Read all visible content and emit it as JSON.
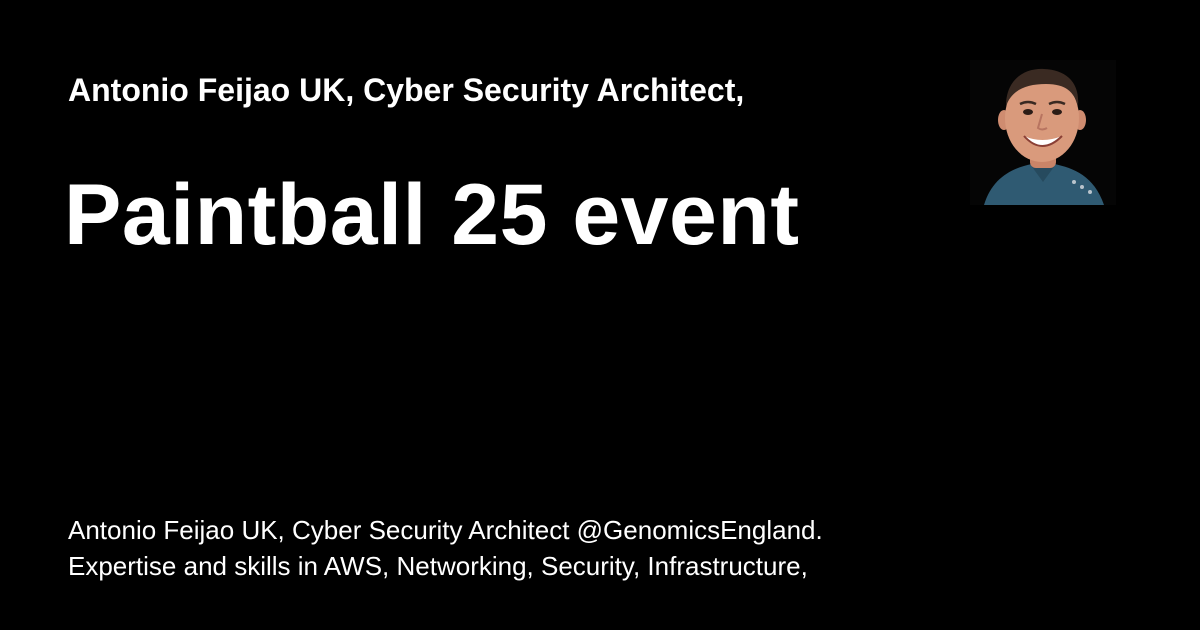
{
  "card": {
    "site_title": "Antonio Feijao UK, Cyber Security Architect,",
    "post_title": "Paintball 25 event",
    "description_lines": [
      "Antonio Feijao UK, Cyber Security Architect @GenomicsEngland.",
      "Expertise and skills in AWS, Networking, Security, Infrastructure,"
    ],
    "avatar": {
      "icon": "author-portrait-photo"
    }
  },
  "colors": {
    "background": "#000000",
    "text": "#ffffff",
    "shirt": "#2f5a72",
    "skin": "#d99a7c",
    "hair": "#3a2a22"
  }
}
